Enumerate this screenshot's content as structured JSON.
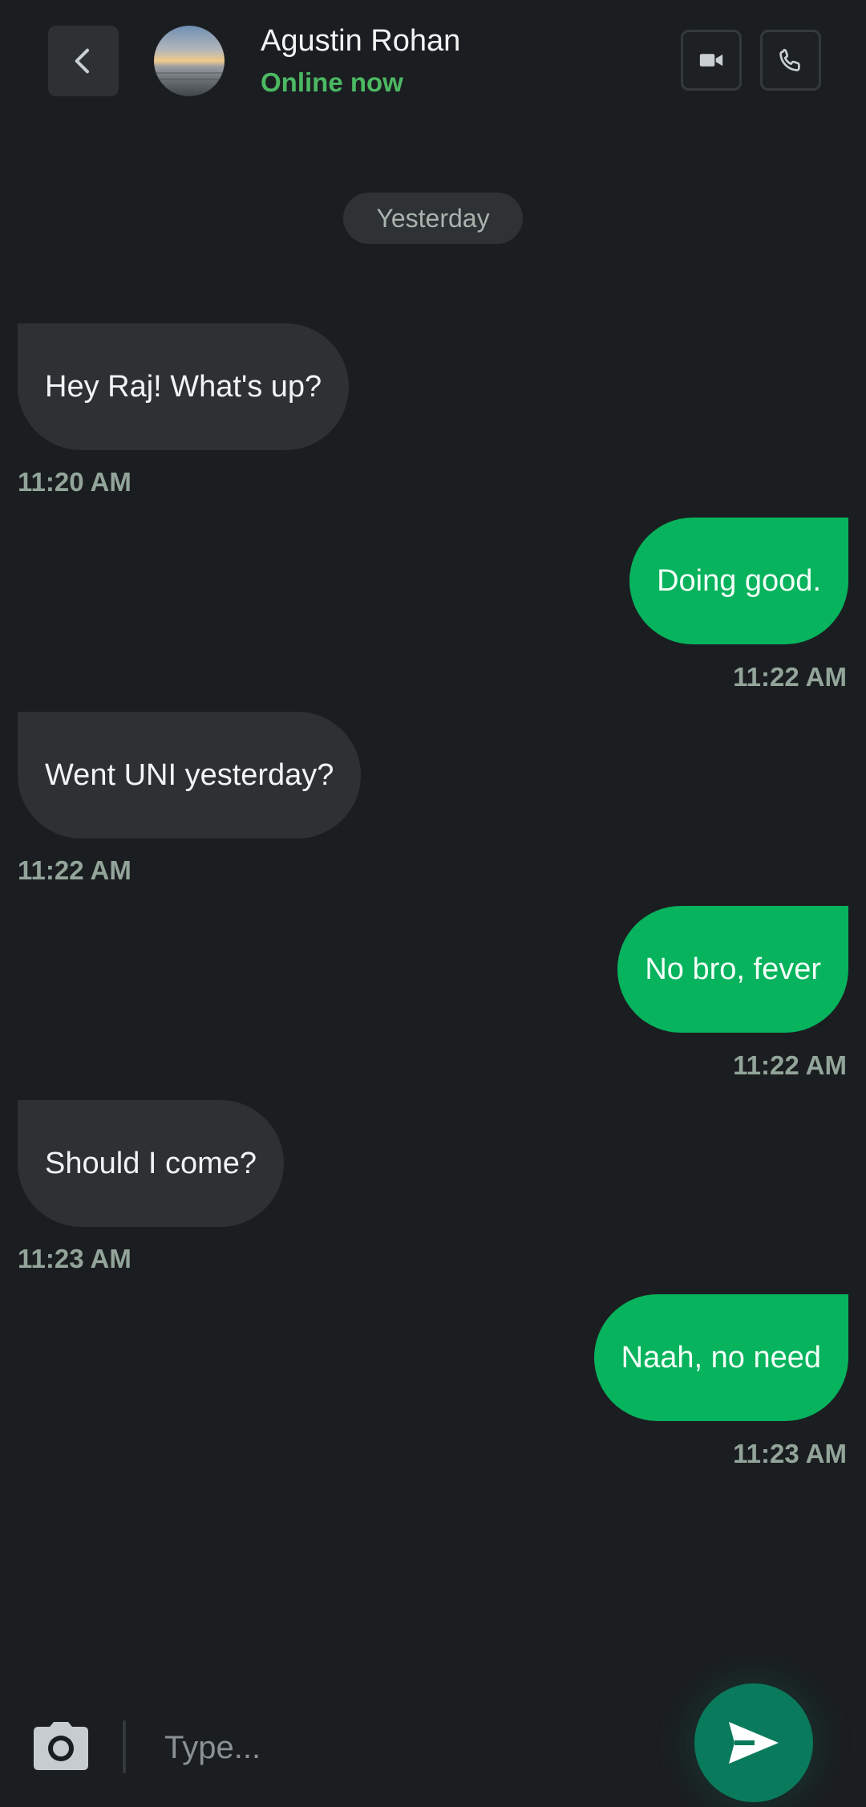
{
  "header": {
    "contact_name": "Agustin Rohan",
    "status": "Online now",
    "back_icon": "chevron-left-icon",
    "video_icon": "video-camera-icon",
    "call_icon": "phone-icon"
  },
  "date_divider": "Yesterday",
  "messages": [
    {
      "direction": "incoming",
      "text": "Hey Raj! What's up?",
      "time": "11:20 AM"
    },
    {
      "direction": "outgoing",
      "text": "Doing good.",
      "time": "11:22 AM"
    },
    {
      "direction": "incoming",
      "text": "Went UNI yesterday?",
      "time": "11:22 AM"
    },
    {
      "direction": "outgoing",
      "text": "No bro, fever",
      "time": "11:22 AM"
    },
    {
      "direction": "incoming",
      "text": "Should I come?",
      "time": "11:23 AM"
    },
    {
      "direction": "outgoing",
      "text": "Naah, no need",
      "time": "11:23 AM"
    }
  ],
  "composer": {
    "placeholder": "Type...",
    "value": "",
    "camera_icon": "camera-icon",
    "send_icon": "send-icon"
  },
  "colors": {
    "background": "#1b1e20",
    "incoming_bubble": "#2d3133",
    "outgoing_bubble": "#07b35d",
    "online_status": "#4cb963",
    "send_button": "#0a7a5c"
  }
}
